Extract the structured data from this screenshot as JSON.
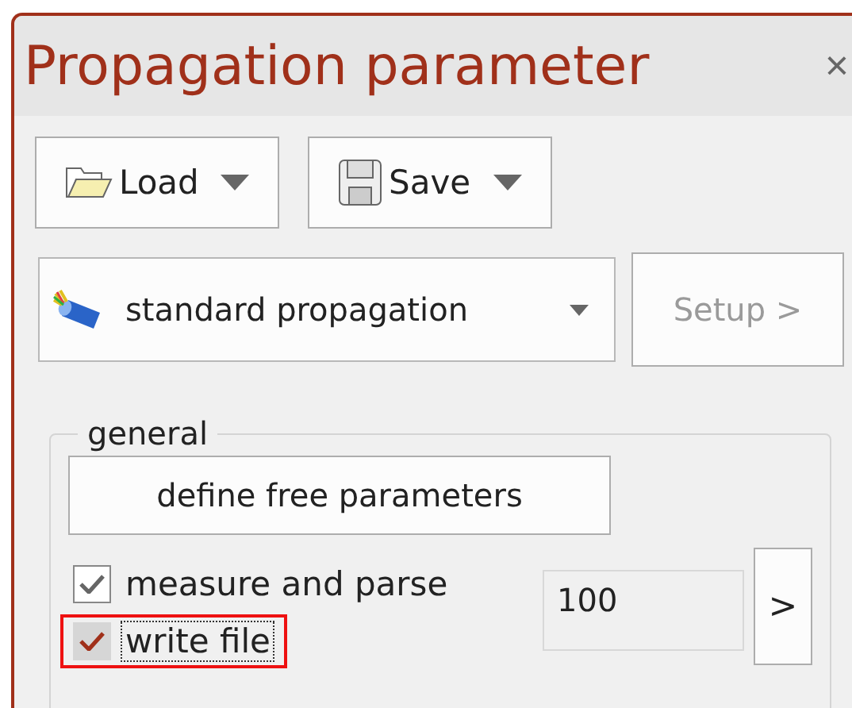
{
  "window": {
    "title": "Propagation parameter",
    "close": "×"
  },
  "toolbar": [
    {
      "kind": "load",
      "label": "Load"
    },
    {
      "kind": "save",
      "label": "Save"
    }
  ],
  "propagation": {
    "value": "standard propagation",
    "setup": {
      "label": "Setup >",
      "disabled": true
    }
  },
  "general": {
    "title": "general",
    "define_button": "define free parameters",
    "checkboxes": [
      {
        "label": "measure and parse",
        "checked": true,
        "focused": false,
        "highlighted": false
      },
      {
        "label": "write file",
        "checked": true,
        "focused": true,
        "highlighted": true
      }
    ],
    "value": "100",
    "next_button": ">"
  }
}
